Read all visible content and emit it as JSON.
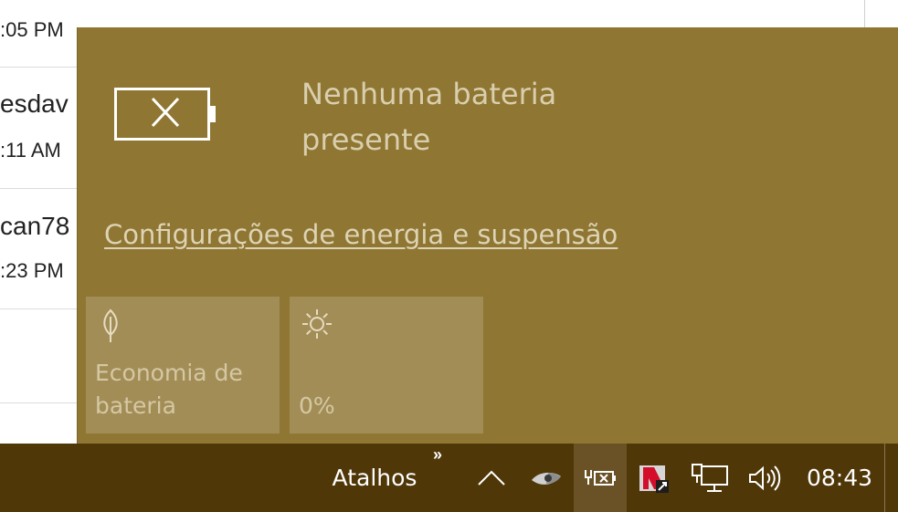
{
  "background_list": {
    "rows": [
      {
        "name": "",
        "time": ":05 PM"
      },
      {
        "name": "esdav",
        "time": ":11 AM"
      },
      {
        "name": "can78",
        "time": ":23 PM"
      }
    ]
  },
  "flyout": {
    "status": "Nenhuma bateria presente",
    "settings_link": "Configurações de energia e suspensão",
    "tiles": [
      {
        "icon": "leaf-icon",
        "label": "Economia de bateria"
      },
      {
        "icon": "brightness-icon",
        "label": "0%"
      }
    ],
    "colors": {
      "background": "#8f7632",
      "tile": "#a38d57",
      "text": "#d9cfae"
    }
  },
  "taskbar": {
    "toolbar_label": "Atalhos",
    "toolbar_more": "»",
    "clock": "08:43",
    "tray_icons": [
      "chevron-up-icon",
      "eye-app-icon",
      "battery-missing-icon",
      "kaspersky-icon",
      "network-icon",
      "volume-icon"
    ],
    "colors": {
      "background": "#4f3708"
    }
  }
}
